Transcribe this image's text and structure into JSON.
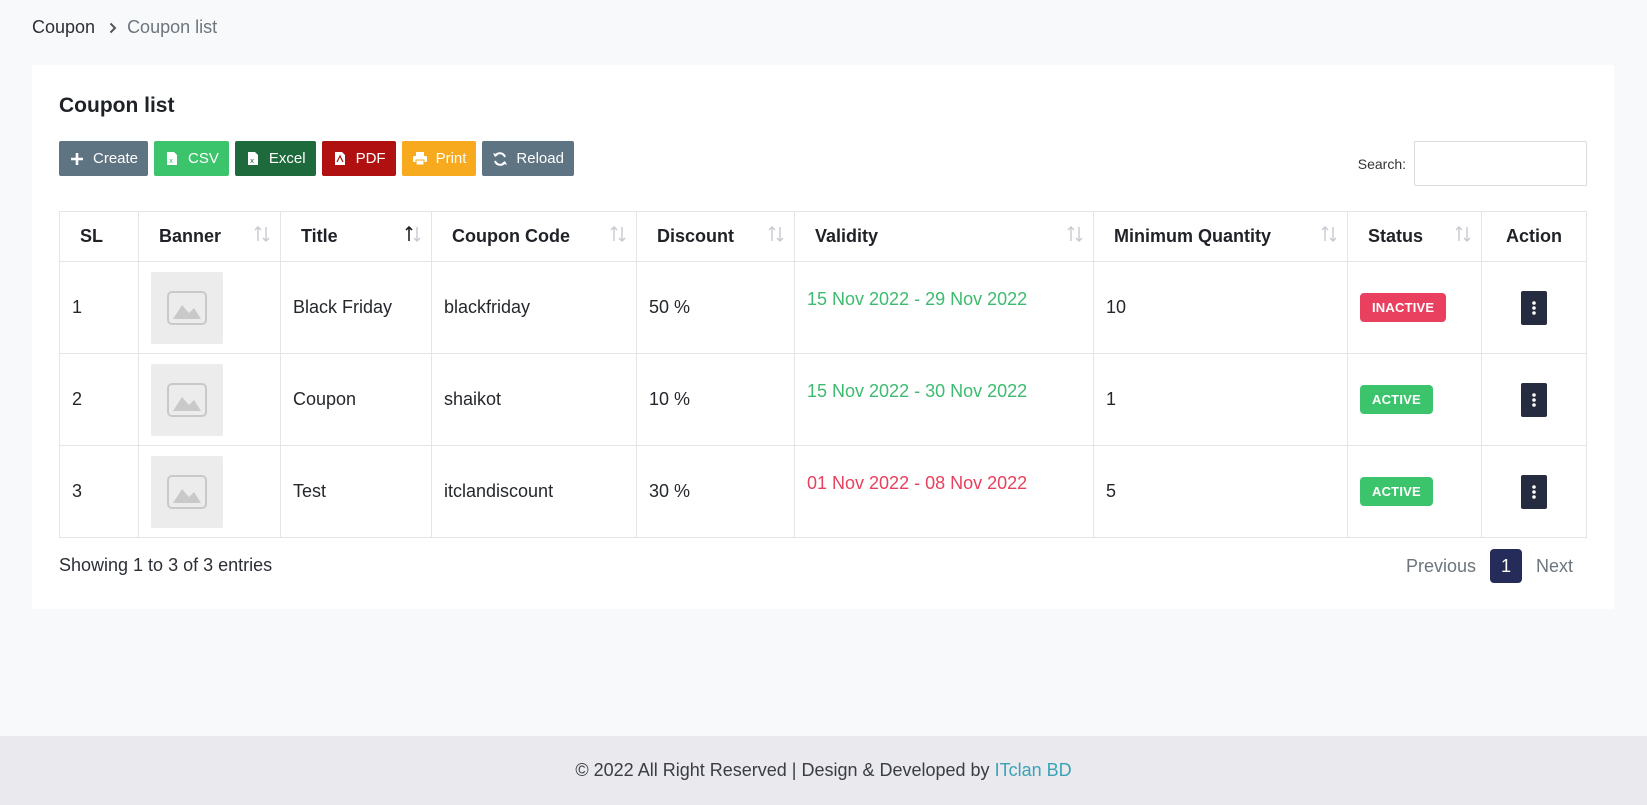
{
  "breadcrumb": {
    "root": "Coupon",
    "current": "Coupon list"
  },
  "card": {
    "title": "Coupon list"
  },
  "toolbar": [
    {
      "label": "Create",
      "icon": "plus-icon",
      "color": "#5f7482"
    },
    {
      "label": "CSV",
      "icon": "csv-file-icon",
      "color": "#3cc46c"
    },
    {
      "label": "Excel",
      "icon": "excel-file-icon",
      "color": "#1e6a3d"
    },
    {
      "label": "PDF",
      "icon": "pdf-file-icon",
      "color": "#b01010"
    },
    {
      "label": "Print",
      "icon": "printer-icon",
      "color": "#f7aa1d"
    },
    {
      "label": "Reload",
      "icon": "refresh-icon",
      "color": "#5f7482"
    }
  ],
  "search": {
    "label": "Search:",
    "value": "",
    "placeholder": ""
  },
  "table": {
    "headers": [
      "SL",
      "Banner",
      "Title",
      "Coupon Code",
      "Discount",
      "Validity",
      "Minimum Quantity",
      "Status",
      "Action"
    ],
    "rows": [
      {
        "sl": "1",
        "title": "Black Friday",
        "code": "blackfriday",
        "discount": "50 %",
        "validity": "15 Nov 2022 - 29 Nov 2022",
        "validity_color": "#3dbb6e",
        "min_qty": "10",
        "status": "INACTIVE",
        "status_color": "#e8405e"
      },
      {
        "sl": "2",
        "title": "Coupon",
        "code": "shaikot",
        "discount": "10 %",
        "validity": "15 Nov 2022 - 30 Nov 2022",
        "validity_color": "#3dbb6e",
        "min_qty": "1",
        "status": "ACTIVE",
        "status_color": "#3cc46c"
      },
      {
        "sl": "3",
        "title": "Test",
        "code": "itclandiscount",
        "discount": "30 %",
        "validity": "01 Nov 2022 - 08 Nov 2022",
        "validity_color": "#e8405e",
        "min_qty": "5",
        "status": "ACTIVE",
        "status_color": "#3cc46c"
      }
    ]
  },
  "info": "Showing 1 to 3 of 3 entries",
  "pagination": {
    "previous": "Previous",
    "current": "1",
    "next": "Next"
  },
  "footer": {
    "text": "© 2022 All Right Reserved | Design & Developed by",
    "brand": "ITclan BD"
  }
}
